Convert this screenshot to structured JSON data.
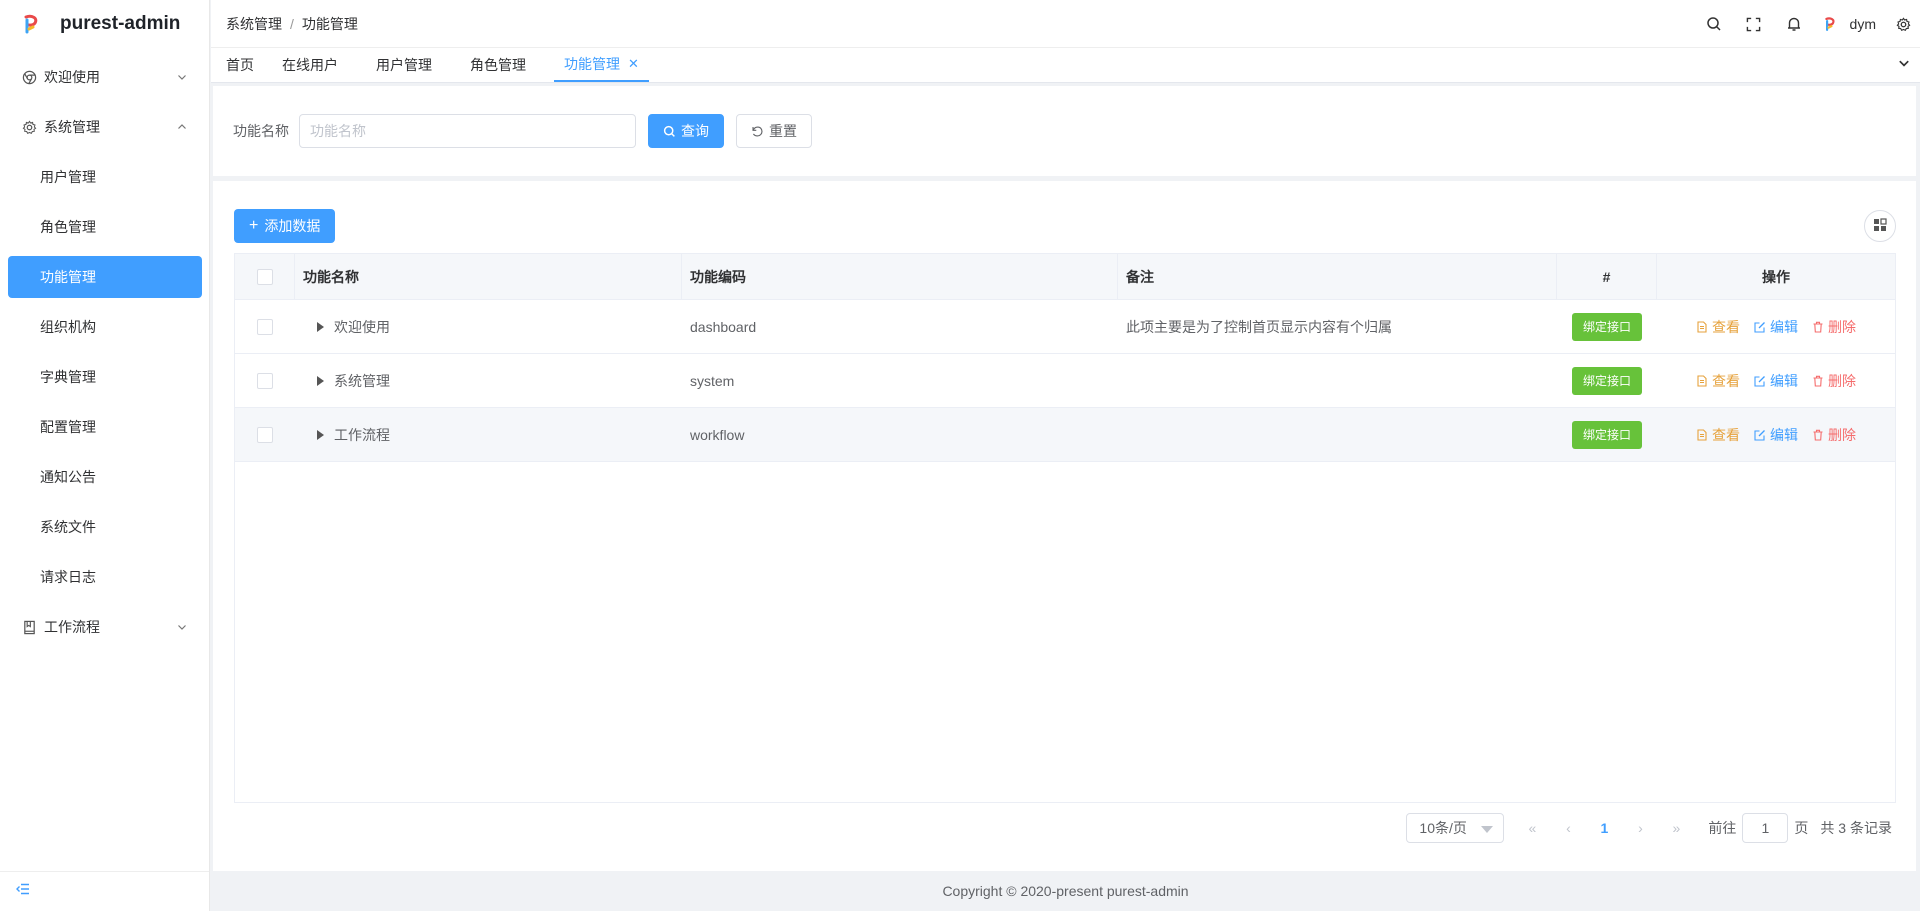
{
  "app": {
    "title": "purest-admin"
  },
  "sidebar": {
    "groups": [
      {
        "label": "欢迎使用",
        "icon": "chrome-icon",
        "expanded": false
      },
      {
        "label": "系统管理",
        "icon": "gear-icon",
        "expanded": true,
        "items": [
          {
            "label": "用户管理"
          },
          {
            "label": "角色管理"
          },
          {
            "label": "功能管理",
            "active": true
          },
          {
            "label": "组织机构"
          },
          {
            "label": "字典管理"
          },
          {
            "label": "配置管理"
          },
          {
            "label": "通知公告"
          },
          {
            "label": "系统文件"
          },
          {
            "label": "请求日志"
          }
        ]
      },
      {
        "label": "工作流程",
        "icon": "book-icon",
        "expanded": false
      }
    ]
  },
  "header": {
    "breadcrumb": [
      "系统管理",
      "功能管理"
    ],
    "user": "dym"
  },
  "tabs": [
    {
      "label": "首页"
    },
    {
      "label": "在线用户"
    },
    {
      "label": "用户管理"
    },
    {
      "label": "角色管理"
    },
    {
      "label": "功能管理",
      "active": true
    }
  ],
  "search": {
    "label": "功能名称",
    "placeholder": "功能名称",
    "query_label": "查询",
    "reset_label": "重置"
  },
  "table": {
    "add_label": "添加数据",
    "columns": [
      "功能名称",
      "功能编码",
      "备注",
      "#",
      "操作"
    ],
    "rows": [
      {
        "name": "欢迎使用",
        "code": "dashboard",
        "remark": "此项主要是为了控制首页显示内容有个归属",
        "bind": "绑定接口"
      },
      {
        "name": "系统管理",
        "code": "system",
        "remark": "",
        "bind": "绑定接口"
      },
      {
        "name": "工作流程",
        "code": "workflow",
        "remark": "",
        "bind": "绑定接口"
      }
    ],
    "actions": {
      "view": "查看",
      "edit": "编辑",
      "delete": "删除"
    }
  },
  "pagination": {
    "page_size": "10条/页",
    "current_page": "1",
    "goto_prefix": "前往",
    "goto_value": "1",
    "goto_suffix": "页",
    "total": "共 3 条记录"
  },
  "footer": {
    "copyright": "Copyright © 2020-present purest-admin"
  },
  "colors": {
    "primary": "#409eff",
    "success": "#67c23a",
    "warning": "#e6a23c",
    "danger": "#f56c6c"
  }
}
